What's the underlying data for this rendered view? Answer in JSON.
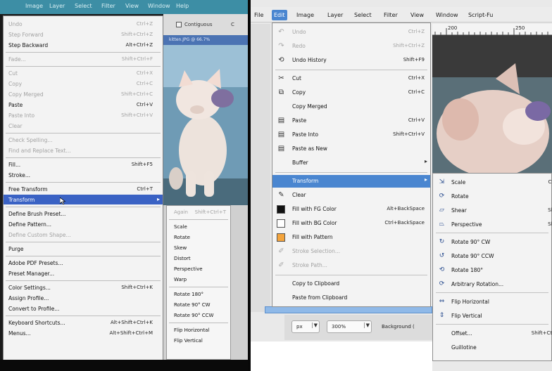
{
  "photoshop": {
    "menubar": [
      "Image",
      "Layer",
      "Select",
      "Filter",
      "View",
      "Window",
      "Help"
    ],
    "options": {
      "contiguous": "Contiguous",
      "c": "C"
    },
    "doc_title": "kitten.JPG @ 66.7%",
    "edit_menu": [
      {
        "label": "Undo",
        "shortcut": "Ctrl+Z",
        "disabled": true
      },
      {
        "label": "Step Forward",
        "shortcut": "Shift+Ctrl+Z",
        "disabled": true
      },
      {
        "label": "Step Backward",
        "shortcut": "Alt+Ctrl+Z",
        "disabled": false
      },
      {
        "label": "Fade...",
        "shortcut": "Shift+Ctrl+F",
        "disabled": true
      },
      {
        "label": "Cut",
        "shortcut": "Ctrl+X",
        "disabled": true
      },
      {
        "label": "Copy",
        "shortcut": "Ctrl+C",
        "disabled": true
      },
      {
        "label": "Copy Merged",
        "shortcut": "Shift+Ctrl+C",
        "disabled": true
      },
      {
        "label": "Paste",
        "shortcut": "Ctrl+V",
        "disabled": false
      },
      {
        "label": "Paste Into",
        "shortcut": "Shift+Ctrl+V",
        "disabled": true
      },
      {
        "label": "Clear",
        "shortcut": "",
        "disabled": true
      },
      {
        "label": "Check Spelling...",
        "shortcut": "",
        "disabled": true
      },
      {
        "label": "Find and Replace Text...",
        "shortcut": "",
        "disabled": true
      },
      {
        "label": "Fill...",
        "shortcut": "Shift+F5",
        "disabled": false
      },
      {
        "label": "Stroke...",
        "shortcut": "",
        "disabled": false
      },
      {
        "label": "Free Transform",
        "shortcut": "Ctrl+T",
        "disabled": false
      },
      {
        "label": "Transform",
        "shortcut": "",
        "disabled": false
      },
      {
        "label": "Define Brush Preset...",
        "shortcut": "",
        "disabled": false
      },
      {
        "label": "Define Pattern...",
        "shortcut": "",
        "disabled": false
      },
      {
        "label": "Define Custom Shape...",
        "shortcut": "",
        "disabled": true
      },
      {
        "label": "Purge",
        "shortcut": "",
        "disabled": false
      },
      {
        "label": "Adobe PDF Presets...",
        "shortcut": "",
        "disabled": false
      },
      {
        "label": "Preset Manager...",
        "shortcut": "",
        "disabled": false
      },
      {
        "label": "Color Settings...",
        "shortcut": "Shift+Ctrl+K",
        "disabled": false
      },
      {
        "label": "Assign Profile...",
        "shortcut": "",
        "disabled": false
      },
      {
        "label": "Convert to Profile...",
        "shortcut": "",
        "disabled": false
      },
      {
        "label": "Keyboard Shortcuts...",
        "shortcut": "Alt+Shift+Ctrl+K",
        "disabled": false
      },
      {
        "label": "Menus...",
        "shortcut": "Alt+Shift+Ctrl+M",
        "disabled": false
      }
    ],
    "transform_submenu": [
      {
        "label": "Again",
        "shortcut": "Shift+Ctrl+T",
        "disabled": true
      },
      {
        "label": "Scale"
      },
      {
        "label": "Rotate"
      },
      {
        "label": "Skew"
      },
      {
        "label": "Distort"
      },
      {
        "label": "Perspective"
      },
      {
        "label": "Warp"
      },
      {
        "label": "Rotate 180°"
      },
      {
        "label": "Rotate 90° CW"
      },
      {
        "label": "Rotate 90° CCW"
      },
      {
        "label": "Flip Horizontal"
      },
      {
        "label": "Flip Vertical"
      }
    ]
  },
  "gimp": {
    "menubar": [
      "File",
      "Edit",
      "Image",
      "Layer",
      "Select",
      "Filter",
      "View",
      "Window",
      "Script-Fu"
    ],
    "ruler": [
      "200",
      "250"
    ],
    "edit_menu": [
      {
        "label": "Undo",
        "shortcut": "Ctrl+Z",
        "icon": "↶",
        "disabled": true
      },
      {
        "label": "Redo",
        "shortcut": "Shift+Ctrl+Z",
        "icon": "↷",
        "disabled": true
      },
      {
        "label": "Undo History",
        "shortcut": "Shift+F9",
        "icon": "⟲",
        "disabled": false
      },
      {
        "label": "Cut",
        "shortcut": "Ctrl+X",
        "icon": "✂",
        "disabled": false
      },
      {
        "label": "Copy",
        "shortcut": "Ctrl+C",
        "icon": "⧉",
        "disabled": false
      },
      {
        "label": "Copy Merged",
        "shortcut": "",
        "icon": "",
        "disabled": false
      },
      {
        "label": "Paste",
        "shortcut": "Ctrl+V",
        "icon": "▤",
        "disabled": false
      },
      {
        "label": "Paste Into",
        "shortcut": "Shift+Ctrl+V",
        "icon": "▤",
        "disabled": false
      },
      {
        "label": "Paste as New",
        "shortcut": "",
        "icon": "▤",
        "disabled": false
      },
      {
        "label": "Buffer",
        "shortcut": "",
        "icon": "",
        "disabled": false
      },
      {
        "label": "Transform",
        "shortcut": "",
        "icon": "",
        "disabled": false
      },
      {
        "label": "Clear",
        "shortcut": "",
        "icon": "✎",
        "disabled": false
      },
      {
        "label": "Fill with FG Color",
        "shortcut": "Alt+BackSpace",
        "icon": "",
        "disabled": false
      },
      {
        "label": "Fill with BG Color",
        "shortcut": "Ctrl+BackSpace",
        "icon": "",
        "disabled": false
      },
      {
        "label": "Fill with Pattern",
        "shortcut": "",
        "icon": "",
        "disabled": false
      },
      {
        "label": "Stroke Selection...",
        "shortcut": "",
        "icon": "✐",
        "disabled": true
      },
      {
        "label": "Stroke Path...",
        "shortcut": "",
        "icon": "✐",
        "disabled": true
      },
      {
        "label": "Copy to Clipboard",
        "shortcut": "",
        "icon": "",
        "disabled": false
      },
      {
        "label": "Paste from Clipboard",
        "shortcut": "",
        "icon": "",
        "disabled": false
      }
    ],
    "transform_submenu": [
      {
        "label": "Scale",
        "shortcut": "Ctr",
        "icon": "⇲"
      },
      {
        "label": "Rotate",
        "shortcut": "",
        "icon": "⟳"
      },
      {
        "label": "Shear",
        "shortcut": "Shi",
        "icon": "▱"
      },
      {
        "label": "Perspective",
        "shortcut": "Shi",
        "icon": "⏢"
      },
      {
        "label": "Rotate 90° CW",
        "shortcut": "",
        "icon": "↻"
      },
      {
        "label": "Rotate 90° CCW",
        "shortcut": "",
        "icon": "↺"
      },
      {
        "label": "Rotate 180°",
        "shortcut": "",
        "icon": "⟲"
      },
      {
        "label": "Arbitrary Rotation...",
        "shortcut": "",
        "icon": "⟳"
      },
      {
        "label": "Flip Horizontal",
        "shortcut": "",
        "icon": "⇔"
      },
      {
        "label": "Flip Vertical",
        "shortcut": "",
        "icon": "⇕"
      },
      {
        "label": "Offset...",
        "shortcut": "Shift+Ctrl",
        "icon": ""
      },
      {
        "label": "Guillotine",
        "shortcut": "",
        "icon": ""
      }
    ],
    "status": {
      "unit": "px",
      "zoom": "300%",
      "info": "Background ("
    },
    "colors": {
      "selection": "#4a86d0",
      "fg": "#111111",
      "bg": "#ffffff",
      "pattern": "#f4a43c"
    }
  }
}
